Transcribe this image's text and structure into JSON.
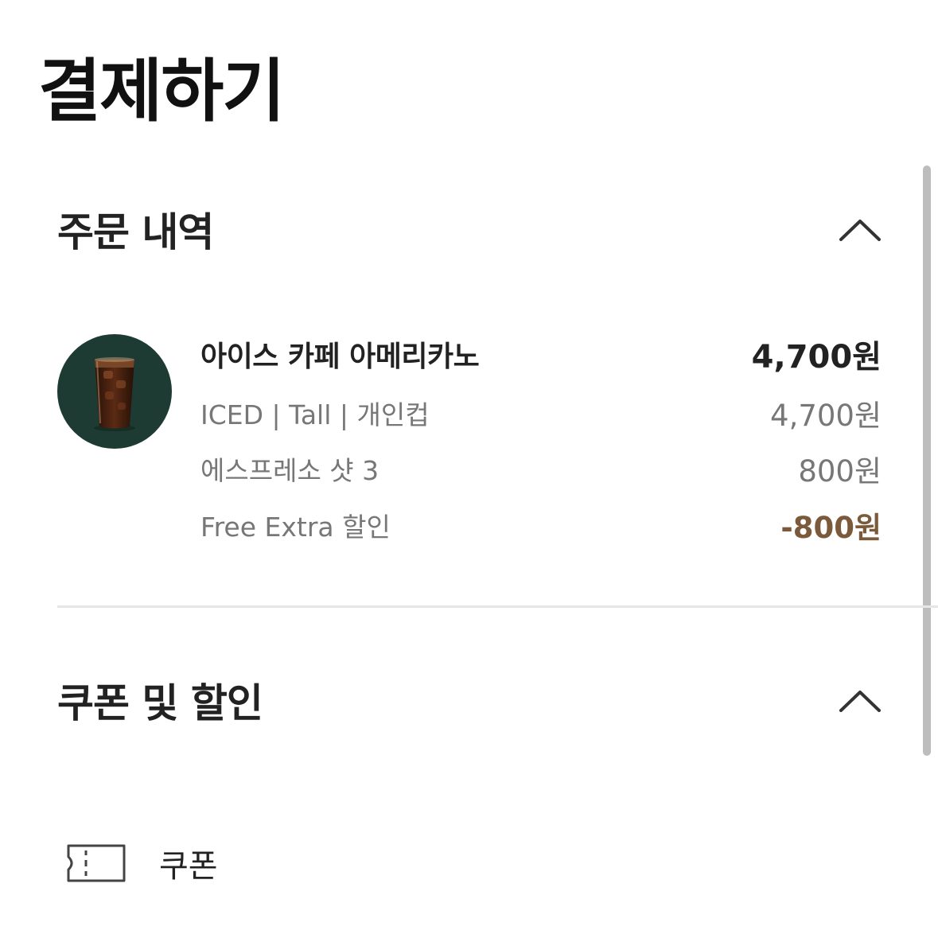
{
  "page": {
    "title": "결제하기"
  },
  "order_section": {
    "title": "주문 내역",
    "toggle_icon": "chevron-up-icon",
    "item": {
      "thumbnail": "iced-americano-image",
      "name": "아이스 카페 아메리카노",
      "total_price": "4,700원",
      "option_label": "ICED | Tall | 개인컵",
      "option_price": "4,700원",
      "extra_label": "에스프레소 샷 3",
      "extra_price": "800원",
      "discount_label": "Free Extra 할인",
      "discount_price": "-800원"
    }
  },
  "coupon_section": {
    "title": "쿠폰 및 할인",
    "toggle_icon": "chevron-up-icon",
    "coupon_item": {
      "icon": "ticket-icon",
      "label": "쿠폰"
    }
  },
  "colors": {
    "thumbnail_bg": "#1d3b33",
    "discount": "#7a5a3a",
    "secondary_text": "#777777",
    "divider": "#e6e6e6",
    "scrollbar": "#bdbdbd"
  }
}
